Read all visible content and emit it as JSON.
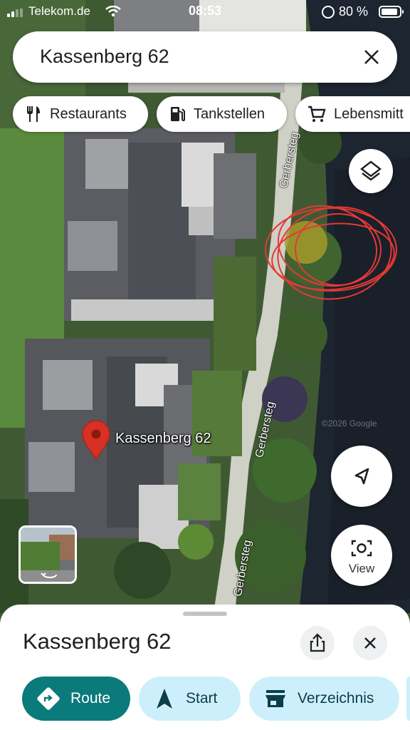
{
  "status": {
    "carrier": "Telekom.de",
    "time": "08:53",
    "battery": "80 %"
  },
  "search": {
    "query": "Kassenberg 62"
  },
  "chips": [
    {
      "label": "Restaurants",
      "icon": "fork-knife-icon"
    },
    {
      "label": "Tankstellen",
      "icon": "gas-station-icon"
    },
    {
      "label": "Lebensmitt",
      "icon": "shopping-cart-icon"
    }
  ],
  "map": {
    "pin_label": "Kassenberg 62",
    "road_labels": [
      "Gerbersteg",
      "Gerbersteg",
      "Gerbersteg"
    ],
    "watermark": "©2026 Google"
  },
  "controls": {
    "view_label": "View"
  },
  "sheet": {
    "title": "Kassenberg 62",
    "actions": [
      {
        "label": "Route",
        "icon": "directions-icon"
      },
      {
        "label": "Start",
        "icon": "navigation-arrow-icon"
      },
      {
        "label": "Verzeichnis",
        "icon": "storefront-icon"
      }
    ]
  },
  "colors": {
    "route_button": "#0b7a7a",
    "tonal_button": "#cdeffb",
    "pin": "#d93025",
    "annotation": "#e53935"
  }
}
